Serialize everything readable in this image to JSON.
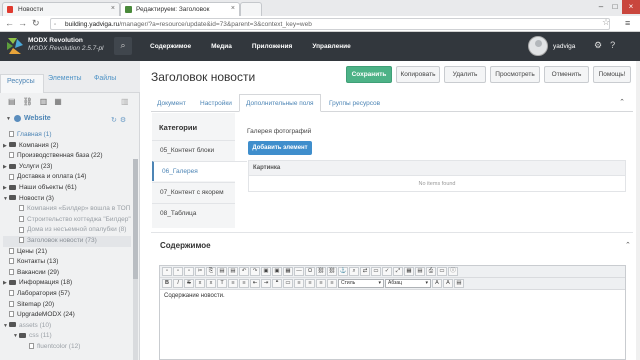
{
  "browser": {
    "tabs": [
      {
        "label": "Новости"
      },
      {
        "label": "Редактируем: Заголовок"
      },
      {
        "label": ""
      }
    ],
    "url_host": "building.yadviga.ru",
    "url_path": "/manager/?a=resource/update&id=73&parent=3&context_key=web"
  },
  "topbar": {
    "brand_name": "MODX Revolution",
    "brand_version": "MODX Revolution 2.5.7-pl",
    "nav": [
      "Содержимое",
      "Медиа",
      "Приложения",
      "Управление"
    ],
    "username": "yadviga"
  },
  "left": {
    "tabs": [
      "Ресурсы",
      "Элементы",
      "Файлы"
    ],
    "site": "Website",
    "tree": [
      {
        "label": "Главная (1)",
        "kind": "doc",
        "style": "link",
        "indent": 0
      },
      {
        "label": "Компания (2)",
        "kind": "folder",
        "style": "",
        "indent": 0
      },
      {
        "label": "Производственная база (22)",
        "kind": "doc",
        "style": "",
        "indent": 0
      },
      {
        "label": "Услуги (23)",
        "kind": "folder",
        "style": "",
        "indent": 0
      },
      {
        "label": "Доставка и оплата (14)",
        "kind": "doc",
        "style": "",
        "indent": 0
      },
      {
        "label": "Наши объекты (61)",
        "kind": "folder",
        "style": "",
        "indent": 0
      },
      {
        "label": "Новости (3)",
        "kind": "folder-open",
        "style": "",
        "indent": 0
      },
      {
        "label": "Компания «Билдер» вошла в ТОП",
        "kind": "doc",
        "style": "gray",
        "indent": 1
      },
      {
        "label": "Строительство коттеджа \"Билдер\"",
        "kind": "doc",
        "style": "gray",
        "indent": 1
      },
      {
        "label": "Дома из несъемной опалубки (8)",
        "kind": "doc",
        "style": "gray",
        "indent": 1
      },
      {
        "label": "Заголовок новости (73)",
        "kind": "doc",
        "style": "sel",
        "indent": 1
      },
      {
        "label": "Цены (21)",
        "kind": "doc",
        "style": "",
        "indent": 0
      },
      {
        "label": "Контакты (13)",
        "kind": "doc",
        "style": "",
        "indent": 0
      },
      {
        "label": "Вакансии (29)",
        "kind": "doc",
        "style": "",
        "indent": 0
      },
      {
        "label": "Информация (18)",
        "kind": "folder",
        "style": "",
        "indent": 0
      },
      {
        "label": "Лаборатория (57)",
        "kind": "doc",
        "style": "",
        "indent": 0
      },
      {
        "label": "Sitemap (20)",
        "kind": "doc",
        "style": "",
        "indent": 0
      },
      {
        "label": "UpgradeMODX (24)",
        "kind": "doc",
        "style": "",
        "indent": 0
      },
      {
        "label": "assets (10)",
        "kind": "folder-open",
        "style": "gray",
        "indent": 0
      },
      {
        "label": "css (11)",
        "kind": "folder-open",
        "style": "gray",
        "indent": 1
      },
      {
        "label": "fluentcolor (12)",
        "kind": "doc",
        "style": "gray",
        "indent": 2
      }
    ]
  },
  "main": {
    "title": "Заголовок новости",
    "actions": [
      "Сохранить",
      "Копировать",
      "Удалить",
      "Просмотреть",
      "Отменить",
      "Помощь!"
    ],
    "tabs": [
      "Документ",
      "Настройки",
      "Дополнительные поля",
      "Группы ресурсов"
    ],
    "categories_title": "Категории",
    "categories": [
      "05_Контент блоки",
      "06_Галерея",
      "07_Контент с якорем",
      "08_Таблица"
    ],
    "gallery_label": "Галерея фотографий",
    "add_button": "Добавить элемент",
    "table_header": "Картинка",
    "table_empty": "No items found",
    "content_heading": "Содержимое",
    "editor_style": "Стиль",
    "editor_format": "Абзац",
    "editor_text": "Содержание новости."
  },
  "colors": {
    "topbar": "#32373d",
    "save": "#4db287",
    "accent": "#4d85b5",
    "add_button": "#3f8ecc"
  }
}
